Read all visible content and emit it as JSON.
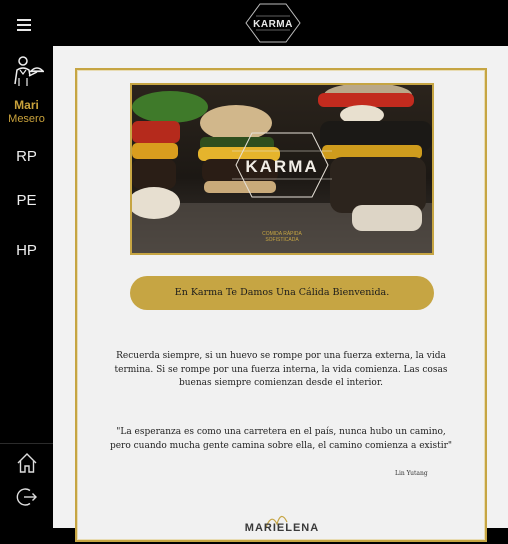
{
  "header": {
    "logo_text": "KARMA"
  },
  "user": {
    "name": "Mari",
    "role": "Mesero"
  },
  "sidebar": {
    "items": [
      {
        "label": "RP"
      },
      {
        "label": "PE"
      },
      {
        "label": "HP"
      }
    ]
  },
  "hero": {
    "brand": "KARMA",
    "tagline_1": "COMIDA RÁPIDA",
    "tagline_2": "SOFISTICADA"
  },
  "main": {
    "welcome_button": "En Karma Te Damos Una Cálida Bienvenida.",
    "quote_1": "Recuerda siempre, si un huevo se rompe por una fuerza externa, la vida termina. Si se rompe por una fuerza interna, la vida comienza. Las cosas buenas siempre comienzan desde el interior.",
    "quote_2": "\"La esperanza es como una carretera en el país, nunca hubo un camino, pero cuando mucha gente camina sobre ella, el camino comienza a existir\"",
    "quote_2_author": "Lin Yutang",
    "footer_logo": "MARIELENA"
  },
  "colors": {
    "accent": "#c6a543",
    "sidebar_bg": "#000000",
    "content_bg": "#f2f2f2",
    "user_text": "#c9a23b"
  },
  "icons": {
    "menu": "hamburger-icon",
    "user": "waiter-icon",
    "home": "home-icon",
    "logout": "logout-icon"
  }
}
